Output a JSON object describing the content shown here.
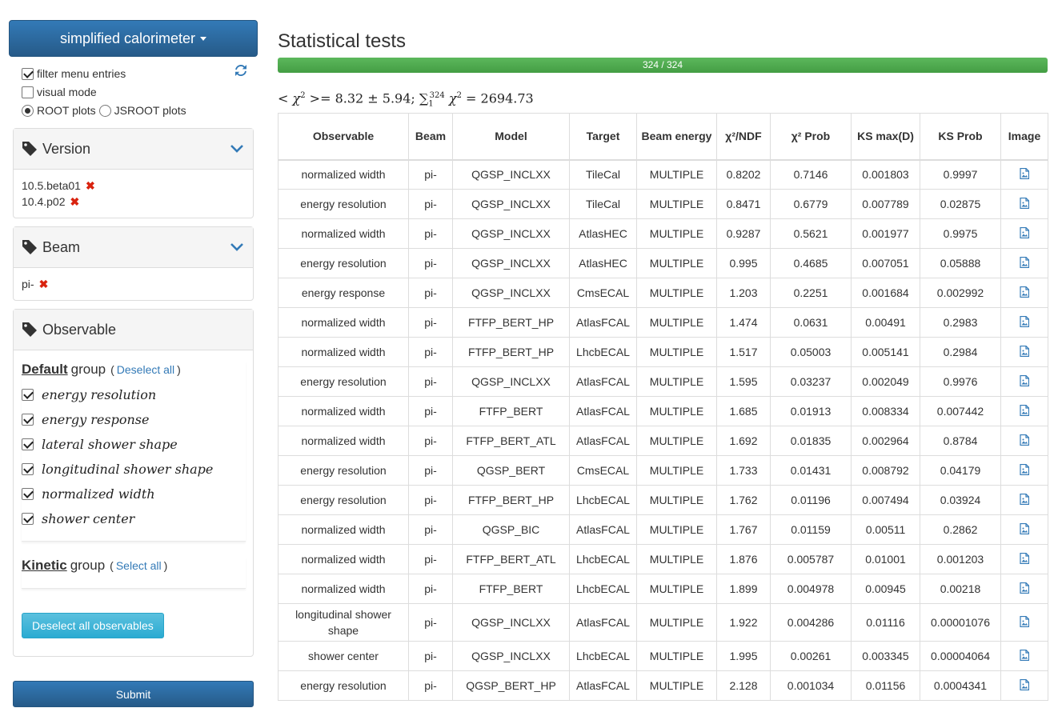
{
  "sidebar": {
    "dropdown_label": "simplified calorimeter",
    "options": {
      "filter_label": "filter menu entries",
      "visual_label": "visual mode",
      "root_label": "ROOT plots",
      "jsroot_label": "JSROOT plots"
    },
    "version_panel": {
      "title": "Version",
      "items": [
        "10.5.beta01",
        "10.4.p02"
      ]
    },
    "beam_panel": {
      "title": "Beam",
      "items": [
        "pi-"
      ]
    },
    "observable_panel": {
      "title": "Observable",
      "default_group": {
        "name": "Default",
        "word": "group",
        "link": "Deselect all",
        "items": [
          "energy resolution",
          "energy response",
          "lateral shower shape",
          "longitudinal shower shape",
          "normalized width",
          "shower center"
        ]
      },
      "kinetic_group": {
        "name": "Kinetic",
        "word": "group",
        "link": "Select all"
      },
      "deselect_button": "Deselect all observables"
    },
    "submit_label": "Submit"
  },
  "main": {
    "title": "Statistical tests",
    "progress": {
      "label": "324 / 324",
      "fraction": 1.0
    },
    "formula": {
      "lhs_open": "<",
      "lhs_chi": "χ",
      "lhs_sup": "2",
      "lhs_close": ">= 8.32 ± 5.94; ∑",
      "sum_sub": "1",
      "sum_sup": "324",
      "rhs_chi": "χ",
      "rhs_sup": "2",
      "rhs_value": "= 2694.73"
    },
    "table": {
      "headers": [
        "Observable",
        "Beam",
        "Model",
        "Target",
        "Beam energy",
        "χ²/NDF",
        "χ² Prob",
        "KS max(D)",
        "KS Prob",
        "Image"
      ],
      "rows": [
        [
          "normalized width",
          "pi-",
          "QGSP_INCLXX",
          "TileCal",
          "MULTIPLE",
          "0.8202",
          "0.7146",
          "0.001803",
          "0.9997"
        ],
        [
          "energy resolution",
          "pi-",
          "QGSP_INCLXX",
          "TileCal",
          "MULTIPLE",
          "0.8471",
          "0.6779",
          "0.007789",
          "0.02875"
        ],
        [
          "normalized width",
          "pi-",
          "QGSP_INCLXX",
          "AtlasHEC",
          "MULTIPLE",
          "0.9287",
          "0.5621",
          "0.001977",
          "0.9975"
        ],
        [
          "energy resolution",
          "pi-",
          "QGSP_INCLXX",
          "AtlasHEC",
          "MULTIPLE",
          "0.995",
          "0.4685",
          "0.007051",
          "0.05888"
        ],
        [
          "energy response",
          "pi-",
          "QGSP_INCLXX",
          "CmsECAL",
          "MULTIPLE",
          "1.203",
          "0.2251",
          "0.001684",
          "0.002992"
        ],
        [
          "normalized width",
          "pi-",
          "FTFP_BERT_HP",
          "AtlasFCAL",
          "MULTIPLE",
          "1.474",
          "0.0631",
          "0.00491",
          "0.2983"
        ],
        [
          "normalized width",
          "pi-",
          "FTFP_BERT_HP",
          "LhcbECAL",
          "MULTIPLE",
          "1.517",
          "0.05003",
          "0.005141",
          "0.2984"
        ],
        [
          "energy resolution",
          "pi-",
          "QGSP_INCLXX",
          "AtlasFCAL",
          "MULTIPLE",
          "1.595",
          "0.03237",
          "0.002049",
          "0.9976"
        ],
        [
          "normalized width",
          "pi-",
          "FTFP_BERT",
          "AtlasFCAL",
          "MULTIPLE",
          "1.685",
          "0.01913",
          "0.008334",
          "0.007442"
        ],
        [
          "normalized width",
          "pi-",
          "FTFP_BERT_ATL",
          "AtlasFCAL",
          "MULTIPLE",
          "1.692",
          "0.01835",
          "0.002964",
          "0.8784"
        ],
        [
          "energy resolution",
          "pi-",
          "QGSP_BERT",
          "CmsECAL",
          "MULTIPLE",
          "1.733",
          "0.01431",
          "0.008792",
          "0.04179"
        ],
        [
          "energy resolution",
          "pi-",
          "FTFP_BERT_HP",
          "LhcbECAL",
          "MULTIPLE",
          "1.762",
          "0.01196",
          "0.007494",
          "0.03924"
        ],
        [
          "normalized width",
          "pi-",
          "QGSP_BIC",
          "AtlasFCAL",
          "MULTIPLE",
          "1.767",
          "0.01159",
          "0.00511",
          "0.2862"
        ],
        [
          "normalized width",
          "pi-",
          "FTFP_BERT_ATL",
          "LhcbECAL",
          "MULTIPLE",
          "1.876",
          "0.005787",
          "0.01001",
          "0.001203"
        ],
        [
          "normalized width",
          "pi-",
          "FTFP_BERT",
          "LhcbECAL",
          "MULTIPLE",
          "1.899",
          "0.004978",
          "0.00945",
          "0.00218"
        ],
        [
          "longitudinal shower shape",
          "pi-",
          "QGSP_INCLXX",
          "AtlasFCAL",
          "MULTIPLE",
          "1.922",
          "0.004286",
          "0.01116",
          "0.00001076"
        ],
        [
          "shower center",
          "pi-",
          "QGSP_INCLXX",
          "LhcbECAL",
          "MULTIPLE",
          "1.995",
          "0.00261",
          "0.003345",
          "0.00004064"
        ],
        [
          "energy resolution",
          "pi-",
          "QGSP_BERT_HP",
          "AtlasFCAL",
          "MULTIPLE",
          "2.128",
          "0.001034",
          "0.01156",
          "0.0004341"
        ]
      ]
    }
  },
  "colors": {
    "primary": "#337ab7",
    "success": "#5cb85c",
    "info": "#5bc0de",
    "danger": "#d9230f"
  }
}
